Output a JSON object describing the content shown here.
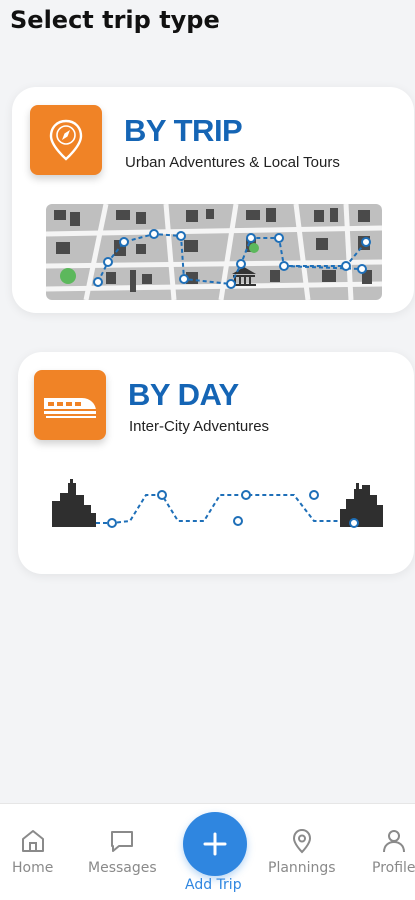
{
  "page": {
    "title": "Select trip type"
  },
  "trip_types": [
    {
      "title": "BY TRIP",
      "subtitle": "Urban Adventures & Local Tours",
      "icon": "compass-pin-icon"
    },
    {
      "title": "BY DAY",
      "subtitle": "Inter-City Adventures",
      "icon": "train-icon"
    }
  ],
  "colors": {
    "accent_orange": "#f08326",
    "title_blue": "#1565b5",
    "primary_blue": "#2f86e0"
  },
  "nav": {
    "home": "Home",
    "messages": "Messages",
    "add_trip": "Add Trip",
    "plannings": "Plannings",
    "profile": "Profile"
  }
}
